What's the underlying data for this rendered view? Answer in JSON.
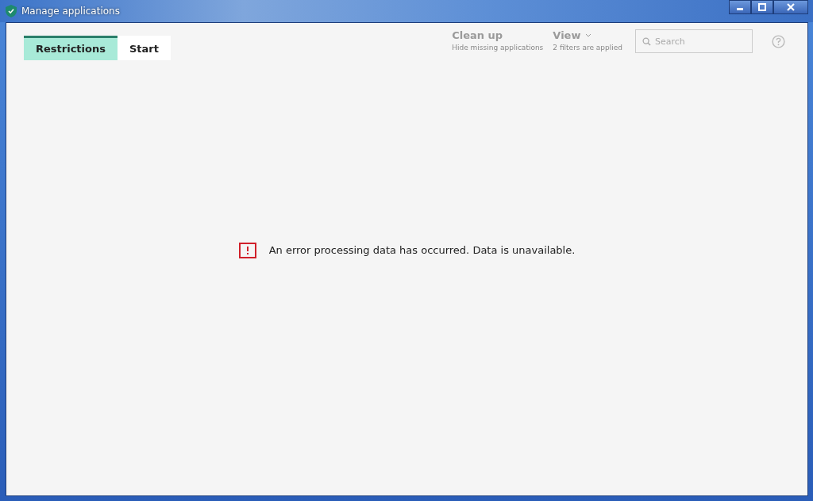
{
  "window": {
    "title": "Manage applications"
  },
  "tabs": [
    {
      "label": "Restrictions",
      "selected": true
    },
    {
      "label": "Start",
      "selected": false
    }
  ],
  "toolbar": {
    "actions": [
      {
        "kind": "plain",
        "label": "Clean up",
        "caption": "Hide missing applications",
        "disabled": true
      },
      {
        "kind": "dropdown",
        "label": "View",
        "caption": "2 filters are applied",
        "disabled": true
      }
    ],
    "search": {
      "placeholder": "Search"
    }
  },
  "message": {
    "text": "An error processing data has occurred. Data is unavailable."
  }
}
